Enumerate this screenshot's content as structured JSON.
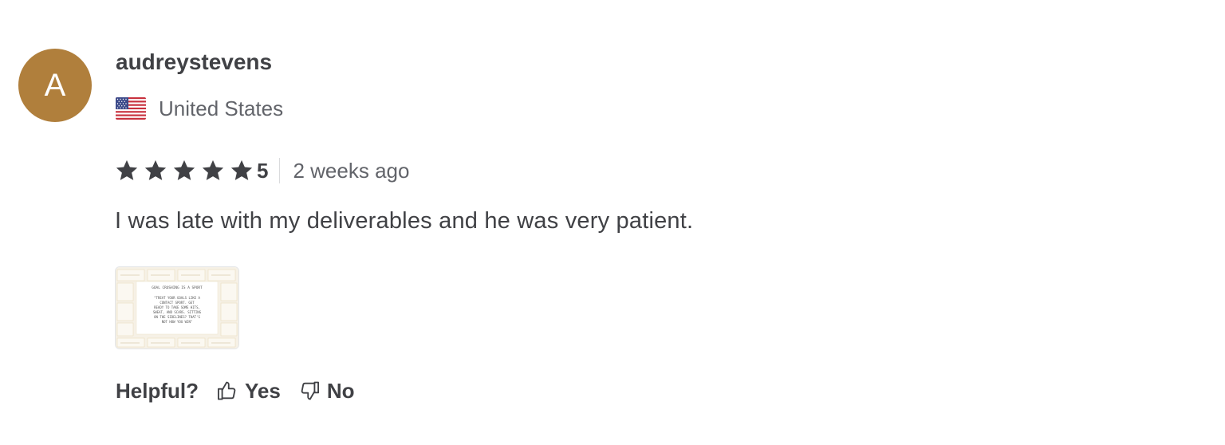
{
  "reviewer": {
    "avatar_initial": "A",
    "avatar_color": "#b07f3c",
    "username": "audreystevens",
    "country": "United States",
    "flag_icon": "us-flag-icon"
  },
  "rating": {
    "stars": 5,
    "value_label": "5",
    "date": "2 weeks ago",
    "star_icon": "star-icon"
  },
  "review": {
    "text": "I was late with my deliverables and he was very patient."
  },
  "attachment": {
    "heading": "GOAL CRUSHING IS A SPORT",
    "lines": [
      "\"TREAT YOUR GOALS LIKE A",
      "CONTACT SPORT. GET",
      "READY TO TAKE SOME HITS,",
      "SWEAT, AND SCARS. SITTING",
      "ON THE SIDELINES? THAT'S",
      "NOT HOW YOU WIN\""
    ]
  },
  "helpful": {
    "label": "Helpful?",
    "yes_label": "Yes",
    "no_label": "No",
    "yes_icon": "thumbs-up-icon",
    "no_icon": "thumbs-down-icon"
  },
  "colors": {
    "text_primary": "#404145",
    "text_secondary": "#62646a",
    "avatar": "#b07f3c",
    "star": "#404145",
    "divider": "#dadbdd"
  }
}
